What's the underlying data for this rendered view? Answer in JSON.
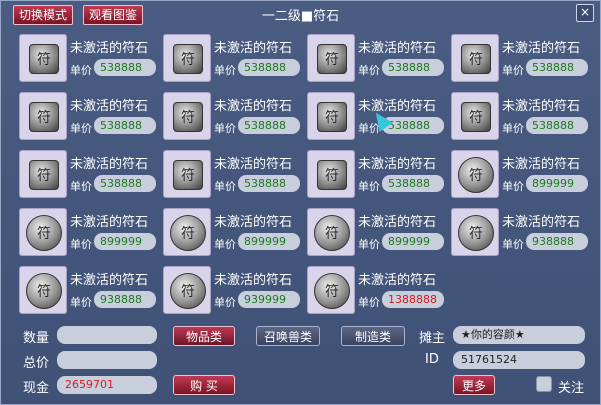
{
  "window": {
    "title": "一二级■符石",
    "switch_mode_label": "切换模式",
    "view_catalog_label": "观看图鉴",
    "close_label": "×"
  },
  "items": [
    {
      "name": "未激活的符石",
      "price_label": "单价",
      "price": "538888",
      "shape": "square",
      "price_color": "green"
    },
    {
      "name": "未激活的符石",
      "price_label": "单价",
      "price": "538888",
      "shape": "square",
      "price_color": "green"
    },
    {
      "name": "未激活的符石",
      "price_label": "单价",
      "price": "538888",
      "shape": "square",
      "price_color": "green"
    },
    {
      "name": "未激活的符石",
      "price_label": "单价",
      "price": "538888",
      "shape": "square",
      "price_color": "green"
    },
    {
      "name": "未激活的符石",
      "price_label": "单价",
      "price": "538888",
      "shape": "square",
      "price_color": "green"
    },
    {
      "name": "未激活的符石",
      "price_label": "单价",
      "price": "538888",
      "shape": "square",
      "price_color": "green"
    },
    {
      "name": "未激活的符石",
      "price_label": "单价",
      "price": "538888",
      "shape": "square",
      "price_color": "green"
    },
    {
      "name": "未激活的符石",
      "price_label": "单价",
      "price": "538888",
      "shape": "square",
      "price_color": "green"
    },
    {
      "name": "未激活的符石",
      "price_label": "单价",
      "price": "538888",
      "shape": "square",
      "price_color": "green"
    },
    {
      "name": "未激活的符石",
      "price_label": "单价",
      "price": "538888",
      "shape": "square",
      "price_color": "green"
    },
    {
      "name": "未激活的符石",
      "price_label": "单价",
      "price": "538888",
      "shape": "square",
      "price_color": "green"
    },
    {
      "name": "未激活的符石",
      "price_label": "单价",
      "price": "899999",
      "shape": "round",
      "price_color": "green"
    },
    {
      "name": "未激活的符石",
      "price_label": "单价",
      "price": "899999",
      "shape": "round",
      "price_color": "green"
    },
    {
      "name": "未激活的符石",
      "price_label": "单价",
      "price": "899999",
      "shape": "round",
      "price_color": "green"
    },
    {
      "name": "未激活的符石",
      "price_label": "单价",
      "price": "899999",
      "shape": "round",
      "price_color": "green"
    },
    {
      "name": "未激活的符石",
      "price_label": "单价",
      "price": "938888",
      "shape": "round",
      "price_color": "green"
    },
    {
      "name": "未激活的符石",
      "price_label": "单价",
      "price": "938888",
      "shape": "round",
      "price_color": "green"
    },
    {
      "name": "未激活的符石",
      "price_label": "单价",
      "price": "939999",
      "shape": "round",
      "price_color": "green"
    },
    {
      "name": "未激活的符石",
      "price_label": "单价",
      "price": "1388888",
      "shape": "round",
      "price_color": "red"
    }
  ],
  "form": {
    "quantity_label": "数量",
    "quantity_value": "",
    "total_label": "总价",
    "total_value": "",
    "cash_label": "现金",
    "cash_value": "2659701",
    "buy_label": "购 买"
  },
  "tabs": [
    {
      "label": "物品类",
      "active": true
    },
    {
      "label": "召唤兽类",
      "active": false
    },
    {
      "label": "制造类",
      "active": false
    }
  ],
  "owner": {
    "label": "摊主",
    "value": "★你的容颜★",
    "id_label": "ID",
    "id_value": "51761524",
    "more_label": "更多",
    "follow_label": "关注"
  },
  "colors": {
    "price_green": "#1c7a1c",
    "price_red": "#d81c1c",
    "accent": "#a3213c"
  }
}
